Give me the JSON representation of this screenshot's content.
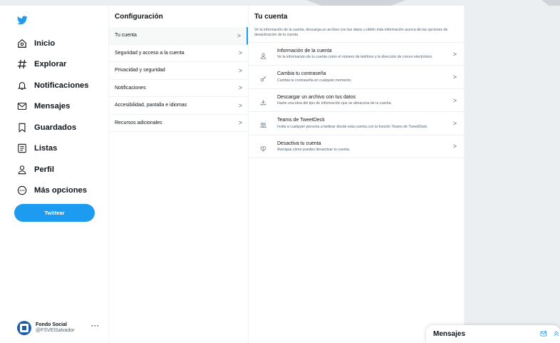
{
  "colors": {
    "accent": "#1d9bf0",
    "text": "#0f1419",
    "muted": "#536471",
    "border": "#eff3f4"
  },
  "nav": {
    "logo_icon": "twitter-bird-icon",
    "items": [
      {
        "label": "Inicio",
        "icon": "home-icon"
      },
      {
        "label": "Explorar",
        "icon": "hashtag-icon"
      },
      {
        "label": "Notificaciones",
        "icon": "bell-icon"
      },
      {
        "label": "Mensajes",
        "icon": "envelope-icon"
      },
      {
        "label": "Guardados",
        "icon": "bookmark-icon"
      },
      {
        "label": "Listas",
        "icon": "list-icon"
      },
      {
        "label": "Perfil",
        "icon": "person-icon"
      },
      {
        "label": "Más opciones",
        "icon": "more-circle-icon"
      }
    ],
    "tweet_button": "Twittear"
  },
  "account": {
    "name": "Fondo Social",
    "handle": "@FSVElSalvador",
    "more": "···"
  },
  "settings": {
    "title": "Configuración",
    "items": [
      {
        "label": "Tu cuenta",
        "active": true
      },
      {
        "label": "Seguridad y acceso a la cuenta"
      },
      {
        "label": "Privacidad y seguridad"
      },
      {
        "label": "Notificaciones"
      },
      {
        "label": "Accesibilidad, pantalla e idiomas"
      },
      {
        "label": "Recursos adicionales"
      }
    ],
    "chevron": ">"
  },
  "detail": {
    "title": "Tu cuenta",
    "intro": "Ve la información de la cuenta, descarga un archivo con tus datos u obtén más información acerca de las opciones de desactivación de la cuenta",
    "rows": [
      {
        "title": "Información de la cuenta",
        "desc": "Ve la información de tu cuenta como el número de teléfono y la dirección de correo electrónico.",
        "icon": "person-icon"
      },
      {
        "title": "Cambia tu contraseña",
        "desc": "Cambia tu contraseña en cualquier momento.",
        "icon": "key-icon"
      },
      {
        "title": "Descargar un archivo con tus datos",
        "desc": "Hazte una idea del tipo de información que se almacena de tu cuenta.",
        "icon": "download-icon"
      },
      {
        "title": "Teams de TweetDeck",
        "desc": "Invita a cualquier persona a twittear desde esta cuenta con la función Teams de TweetDeck.",
        "icon": "team-icon"
      },
      {
        "title": "Desactiva tu cuenta",
        "desc": "Averigua cómo puedes desactivar tu cuenta.",
        "icon": "broken-heart-icon"
      }
    ]
  },
  "messages_drawer": {
    "title": "Mensajes",
    "icons": [
      "new-message-icon",
      "chevron-up-icon"
    ]
  }
}
